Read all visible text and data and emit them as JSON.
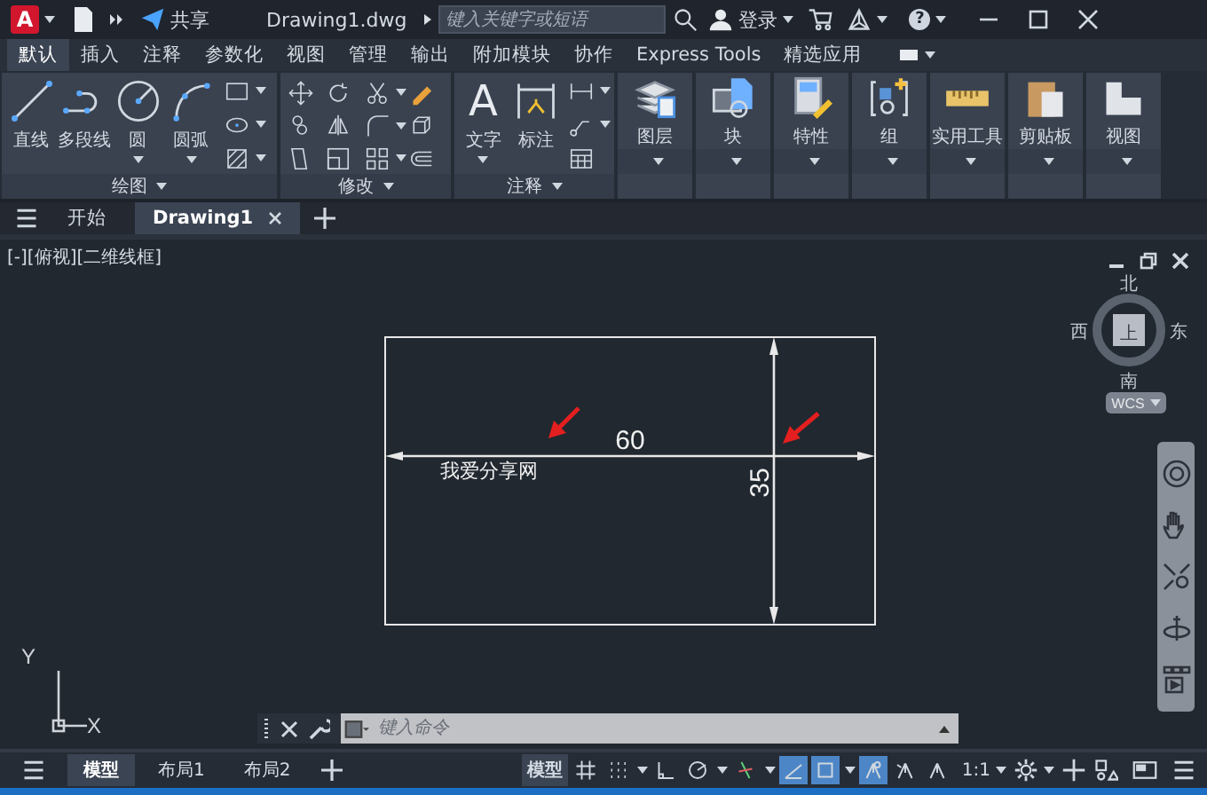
{
  "title_bar": {
    "logo": "A",
    "share": "共享",
    "file_name": "Drawing1.dwg",
    "search": {
      "placeholder": "键入关键字或短语"
    },
    "sign_in": "登录",
    "help": "?"
  },
  "ribbon_tabs": [
    {
      "label": "默认",
      "selected": true
    },
    {
      "label": "插入",
      "selected": false
    },
    {
      "label": "注释",
      "selected": false
    },
    {
      "label": "参数化",
      "selected": false
    },
    {
      "label": "视图",
      "selected": false
    },
    {
      "label": "管理",
      "selected": false
    },
    {
      "label": "输出",
      "selected": false
    },
    {
      "label": "附加模块",
      "selected": false
    },
    {
      "label": "协作",
      "selected": false
    },
    {
      "label": "Express Tools",
      "selected": false
    },
    {
      "label": "精选应用",
      "selected": false
    }
  ],
  "draw_panel": {
    "title": "绘图",
    "tools": [
      "直线",
      "多段线",
      "圆",
      "圆弧"
    ]
  },
  "modify_panel": {
    "title": "修改"
  },
  "annotation_panel": {
    "title": "注释",
    "text_tool": {
      "glyph": "A",
      "label": "文字"
    },
    "dimension_tool": "标注"
  },
  "ribbon_buttons": [
    "图层",
    "块",
    "特性",
    "组",
    "实用工具",
    "剪贴板",
    "视图"
  ],
  "file_tabs": [
    {
      "label": "开始",
      "selected": false
    },
    {
      "label": "Drawing1",
      "selected": true
    }
  ],
  "viewport_label": "[-][俯视][二维线框]",
  "drawing": {
    "note": "我爱分享网",
    "width_dimension": "60",
    "height_dimension": "35"
  },
  "ucs_icon": {
    "x_label": "X",
    "y_label": "Y"
  },
  "viewcube": {
    "north": "北",
    "south": "南",
    "east": "东",
    "west": "西",
    "face": "上",
    "coordinate_system": "WCS"
  },
  "command_line": {
    "placeholder": "键入命令"
  },
  "layout_tabs": [
    {
      "label": "模型",
      "selected": true
    },
    {
      "label": "布局1",
      "selected": false
    },
    {
      "label": "布局2",
      "selected": false
    }
  ],
  "status_bar": {
    "space": "模型",
    "annotation_scale": "1:1",
    "toggles": [
      {
        "on": false
      },
      {
        "on": false
      },
      {
        "on": false
      },
      {
        "on": false
      },
      {
        "on": false
      },
      {
        "on": true
      },
      {
        "on": true
      },
      {
        "on": true
      },
      {
        "on": false
      },
      {
        "on": false
      }
    ]
  }
}
